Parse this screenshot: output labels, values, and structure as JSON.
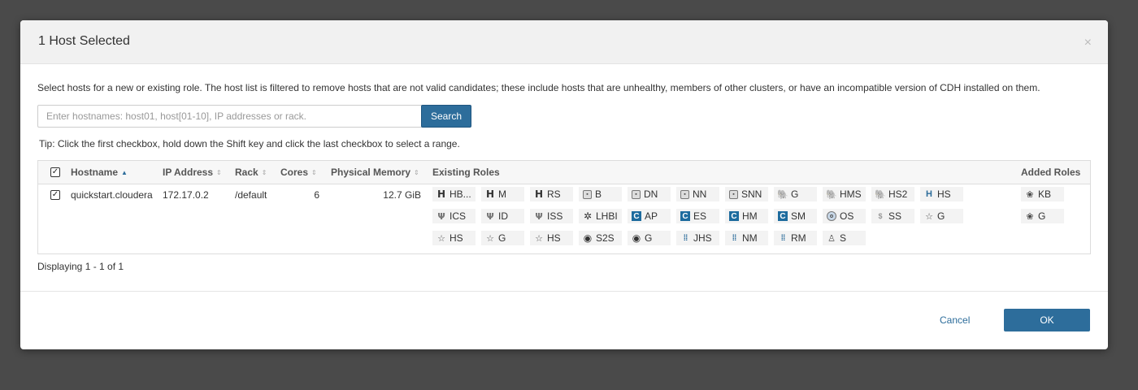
{
  "modal": {
    "title": "1 Host Selected",
    "close": "×",
    "intro": "Select hosts for a new or existing role. The host list is filtered to remove hosts that are not valid candidates; these include hosts that are unhealthy, members of other clusters, or have an incompatible version of CDH installed on them.",
    "search_placeholder": "Enter hostnames: host01, host[01-10], IP addresses or rack.",
    "search_button": "Search",
    "tip": "Tip: Click the first checkbox, hold down the Shift key and click the last checkbox to select a range.",
    "status": "Displaying 1 - 1 of 1",
    "cancel": "Cancel",
    "ok": "OK"
  },
  "table": {
    "headers": {
      "hostname": "Hostname",
      "ip": "IP Address",
      "rack": "Rack",
      "cores": "Cores",
      "memory": "Physical Memory",
      "existing_roles": "Existing Roles",
      "added_roles": "Added Roles"
    },
    "row": {
      "checked": true,
      "hostname": "quickstart.cloudera",
      "ip": "172.17.0.2",
      "rack": "/default",
      "cores": "6",
      "memory": "12.7 GiB"
    },
    "existing_roles": [
      {
        "label": "HB...",
        "icon": "hbase-icon",
        "glyph": "H",
        "cls": "hb"
      },
      {
        "label": "M",
        "icon": "hbase-icon",
        "glyph": "H",
        "cls": "hb"
      },
      {
        "label": "RS",
        "icon": "hbase-icon",
        "glyph": "H",
        "cls": "hb"
      },
      {
        "label": "B",
        "icon": "hdfs-icon",
        "glyph": "▪",
        "cls": "box"
      },
      {
        "label": "DN",
        "icon": "hdfs-icon",
        "glyph": "▪",
        "cls": "box"
      },
      {
        "label": "NN",
        "icon": "hdfs-icon",
        "glyph": "▪",
        "cls": "box"
      },
      {
        "label": "SNN",
        "icon": "hdfs-icon",
        "glyph": "▪",
        "cls": "box"
      },
      {
        "label": "G",
        "icon": "hive-icon",
        "glyph": "🐘",
        "cls": "eleph"
      },
      {
        "label": "HMS",
        "icon": "hive-icon",
        "glyph": "🐘",
        "cls": "eleph"
      },
      {
        "label": "HS2",
        "icon": "hive-icon",
        "glyph": "🐘",
        "cls": "eleph"
      },
      {
        "label": "HS",
        "icon": "hue-icon",
        "glyph": "H",
        "cls": "hsw"
      },
      {
        "label": "ICS",
        "icon": "impala-icon",
        "glyph": "Ψ",
        "cls": "fork"
      },
      {
        "label": "ID",
        "icon": "impala-icon",
        "glyph": "Ψ",
        "cls": "fork"
      },
      {
        "label": "ISS",
        "icon": "impala-icon",
        "glyph": "Ψ",
        "cls": "fork"
      },
      {
        "label": "LHBI",
        "icon": "key-value-indexer-icon",
        "glyph": "✲",
        "cls": "gear"
      },
      {
        "label": "AP",
        "icon": "cloudera-management-icon",
        "glyph": "C",
        "cls": "cblue"
      },
      {
        "label": "ES",
        "icon": "cloudera-management-icon",
        "glyph": "C",
        "cls": "cblue"
      },
      {
        "label": "HM",
        "icon": "cloudera-management-icon",
        "glyph": "C",
        "cls": "cblue"
      },
      {
        "label": "SM",
        "icon": "cloudera-management-icon",
        "glyph": "C",
        "cls": "cblue"
      },
      {
        "label": "OS",
        "icon": "oozie-icon",
        "glyph": "o",
        "cls": "os"
      },
      {
        "label": "SS",
        "icon": "solr-icon",
        "glyph": "$",
        "cls": "ss"
      },
      {
        "label": "G",
        "icon": "spark-icon",
        "glyph": "☆",
        "cls": "star"
      },
      {
        "label": "HS",
        "icon": "spark-icon",
        "glyph": "☆",
        "cls": "star"
      },
      {
        "label": "G",
        "icon": "spark-icon",
        "glyph": "☆",
        "cls": "star"
      },
      {
        "label": "HS",
        "icon": "spark-icon",
        "glyph": "☆",
        "cls": "star"
      },
      {
        "label": "S2S",
        "icon": "sqoop-icon",
        "glyph": "◉",
        "cls": "circ"
      },
      {
        "label": "G",
        "icon": "sqoop-icon",
        "glyph": "◉",
        "cls": "circ"
      },
      {
        "label": "JHS",
        "icon": "yarn-icon",
        "glyph": "⁞⁞",
        "cls": "grid"
      },
      {
        "label": "NM",
        "icon": "yarn-icon",
        "glyph": "⁞⁞",
        "cls": "grid"
      },
      {
        "label": "RM",
        "icon": "yarn-icon",
        "glyph": "⁞⁞",
        "cls": "grid"
      },
      {
        "label": "S",
        "icon": "zookeeper-icon",
        "glyph": "♙",
        "cls": "person"
      }
    ],
    "added_roles": [
      {
        "label": "KB",
        "icon": "kafka-icon",
        "glyph": "❀",
        "cls": "kb"
      },
      {
        "label": "G",
        "icon": "kafka-icon",
        "glyph": "❀",
        "cls": "kb"
      }
    ]
  }
}
